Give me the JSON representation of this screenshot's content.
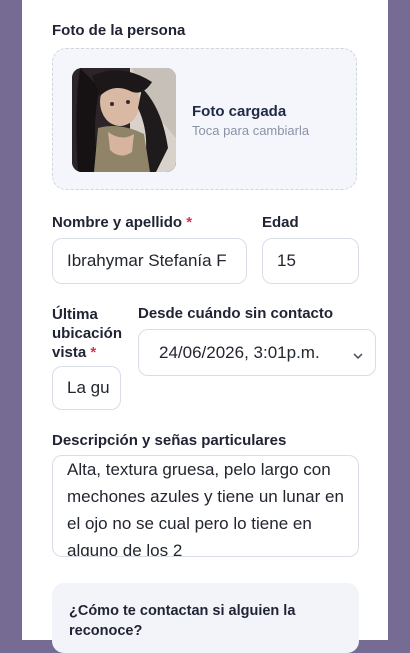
{
  "photo": {
    "label": "Foto de la persona",
    "title": "Foto cargada",
    "subtitle": "Toca para cambiarla"
  },
  "name": {
    "label": "Nombre y apellido",
    "required_mark": "*",
    "value": "Ibrahymar Stefanía F"
  },
  "age": {
    "label": "Edad",
    "value": "15"
  },
  "last_location": {
    "label_line1": "Última",
    "label_line2": "ubicación",
    "label_line3": "vista",
    "required_mark": "*",
    "value": "La gu"
  },
  "since": {
    "label": "Desde cuándo sin contacto",
    "value": "24/06/2026, 3:01p.m."
  },
  "description": {
    "label": "Descripción y señas particulares",
    "value": "Alta, textura gruesa, pelo largo con mechones azules y tiene un lunar en el ojo no se cual pero lo tiene en alguno de los 2"
  },
  "contact": {
    "question": "¿Cómo te contactan si alguien la reconoce?"
  },
  "colors": {
    "background": "#756b93",
    "required": "#d8324a"
  }
}
